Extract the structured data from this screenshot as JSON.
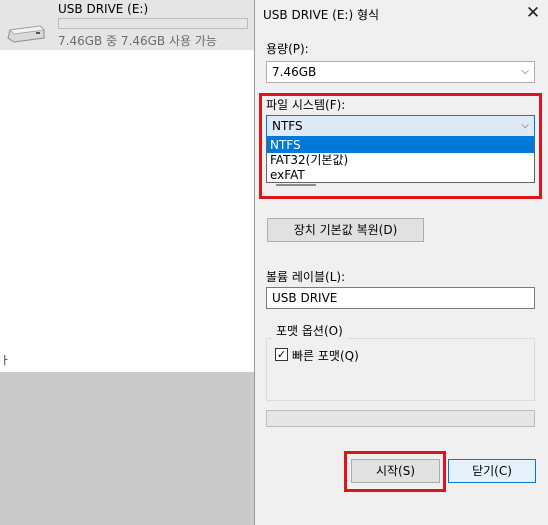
{
  "explorer": {
    "drive_name": "USB DRIVE (E:)",
    "drive_space": "7.46GB 중 7.46GB 사용 가능",
    "drive_usage_fraction": 0.0,
    "left_edge_char": "ㅏ"
  },
  "dialog": {
    "title": "USB DRIVE (E:) 형식",
    "close_glyph": "✕",
    "capacity": {
      "label": "용량(P):",
      "value": "7.46GB"
    },
    "filesystem": {
      "label": "파일 시스템(F):",
      "value": "NTFS",
      "options": [
        "NTFS",
        "FAT32(기본값)",
        "exFAT"
      ]
    },
    "restore_defaults_label": "장치 기본값 복원(D)",
    "volume_label": {
      "label": "볼륨 레이블(L):",
      "value": "USB DRIVE"
    },
    "format_options": {
      "title": "포맷 옵션(O)",
      "quick_format_label": "빠른 포맷(Q)",
      "quick_format_checked": true,
      "check_glyph": "✓"
    },
    "progress_fraction": 0.0,
    "start_label": "시작(S)",
    "close_label": "닫기(C)",
    "dropdown_arrow": "⌵"
  },
  "colors": {
    "highlight": "#e0121b",
    "accent": "#0078d7"
  }
}
